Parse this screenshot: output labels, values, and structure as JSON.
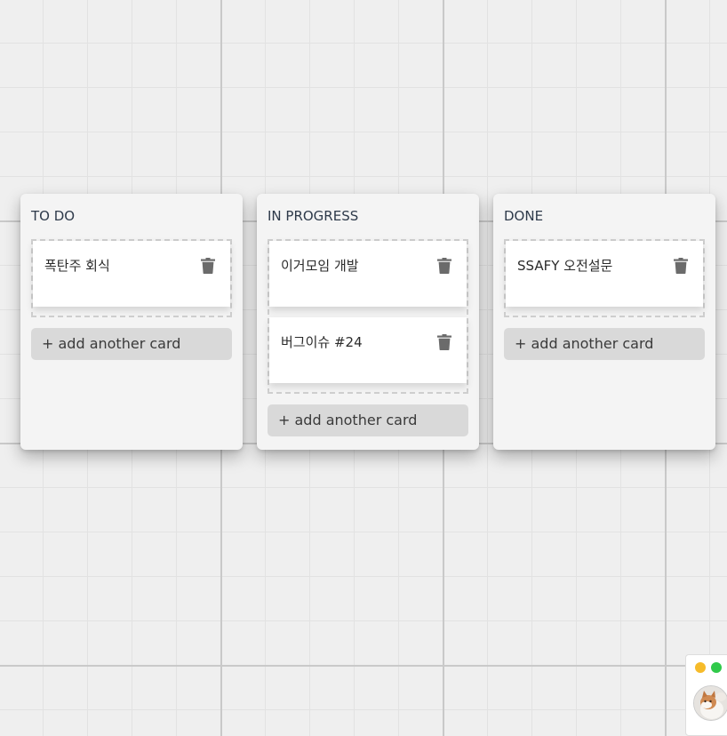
{
  "columns": [
    {
      "title": "TO DO",
      "add_label": "+ add another card",
      "cards": [
        {
          "text": "폭탄주 회식"
        }
      ]
    },
    {
      "title": "IN PROGRESS",
      "add_label": "+ add another card",
      "cards": [
        {
          "text": "이거모임 개발"
        },
        {
          "text": "버그이슈 #24"
        }
      ]
    },
    {
      "title": "DONE",
      "add_label": "+ add another card",
      "cards": [
        {
          "text": "SSAFY 오전설문"
        }
      ]
    }
  ],
  "icons": {
    "delete": "trash-icon",
    "window_minimize": "yellow-dot-icon",
    "window_maximize": "green-dot-icon",
    "avatar": "cat-avatar"
  },
  "colors": {
    "minimize_dot": "#f6bb2a",
    "maximize_dot": "#30c94a",
    "trash": "#6b6b6b",
    "add_button_bg": "#d9d9d9"
  }
}
